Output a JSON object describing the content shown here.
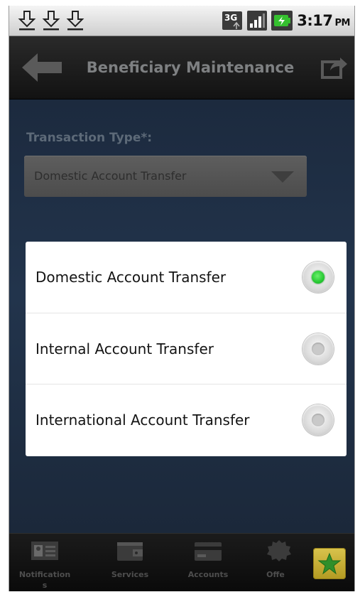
{
  "status_bar": {
    "download_icons": [
      "download-icon",
      "download-icon",
      "download-icon"
    ],
    "network": "3G",
    "time": "3:17",
    "ampm": "PM"
  },
  "header": {
    "title": "Beneficiary Maintenance",
    "back_icon": "back-arrow-icon",
    "share_icon": "share-icon"
  },
  "form": {
    "transaction_type_label": "Transaction Type*:",
    "transaction_type_value": "Domestic Account Transfer"
  },
  "dialog": {
    "options": [
      {
        "label": "Domestic Account Transfer",
        "selected": true
      },
      {
        "label": "Internal Account Transfer",
        "selected": false
      },
      {
        "label": "International Account Transfer",
        "selected": false
      }
    ]
  },
  "nav": {
    "items": [
      {
        "label": "Notification",
        "label_wrap": "s",
        "icon": "contact-card-icon"
      },
      {
        "label": "Services",
        "icon": "wallet-icon"
      },
      {
        "label": "Accounts",
        "icon": "card-icon"
      },
      {
        "label": "Offe",
        "icon": "badge-icon"
      }
    ],
    "favorite_icon": "star-icon"
  },
  "colors": {
    "accent_green": "#1dc22a",
    "content_bg": "#22344c",
    "favorite_gold": "#c9b033"
  }
}
